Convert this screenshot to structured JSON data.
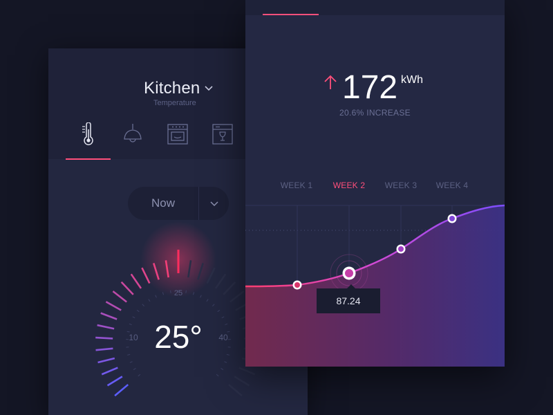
{
  "colors": {
    "background": "#141625",
    "panel": "#242843",
    "accent": "#ff4f7b",
    "purple": "#7c4dff",
    "muted_text": "#5c6183"
  },
  "kitchen_card": {
    "title": "Kitchen",
    "subtitle": "Temperature",
    "device_tabs": [
      "thermometer-icon",
      "lamp-icon",
      "oven-icon",
      "dishwasher-icon"
    ],
    "active_tab_index": 0,
    "period_select": {
      "value": "Now"
    },
    "gauge": {
      "temperature": "25°",
      "value": 25,
      "tick_labels": [
        "10",
        "25",
        "40"
      ]
    }
  },
  "energy_card": {
    "value": "172",
    "unit": "kWh",
    "subtitle": "20.6% INCREASE",
    "trend_icon": "up-arrow-icon",
    "weeks": [
      "WEEK 1",
      "WEEK 2",
      "WEEK 3",
      "WEEK 4"
    ],
    "active_week_index": 1,
    "tooltip": "87.24"
  }
}
